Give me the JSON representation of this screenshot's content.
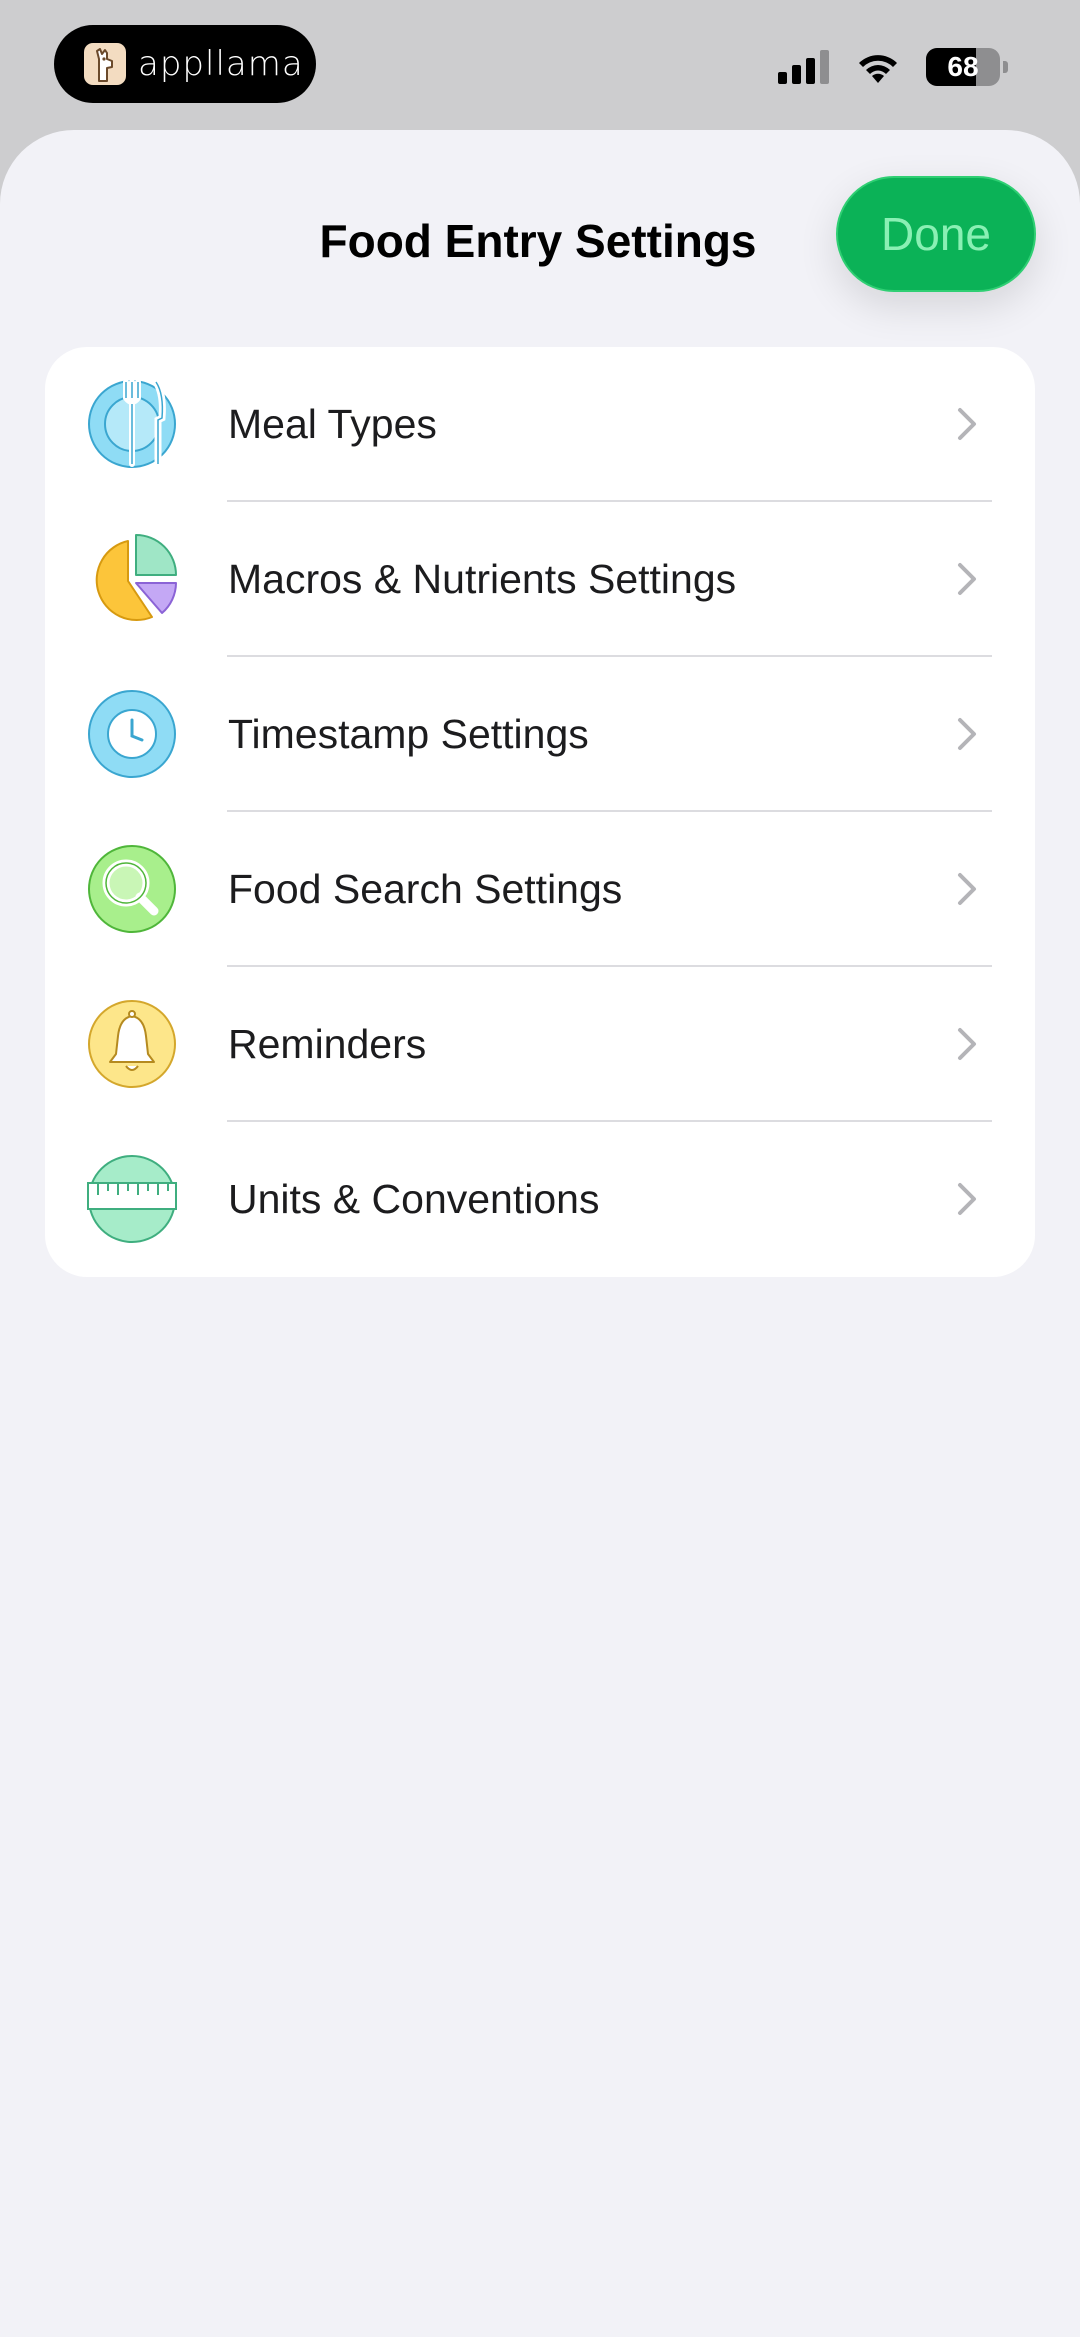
{
  "status_bar": {
    "app_name": "appllama",
    "battery_level": "68",
    "battery_fraction": 0.68
  },
  "sheet": {
    "title": "Food Entry Settings",
    "done_label": "Done"
  },
  "colors": {
    "accent_green": "#0bb257",
    "sheet_background": "#f2f2f7"
  },
  "settings": [
    {
      "label": "Meal Types",
      "icon": "plate-fork-knife-icon"
    },
    {
      "label": "Macros & Nutrients Settings",
      "icon": "pie-chart-icon"
    },
    {
      "label": "Timestamp Settings",
      "icon": "clock-icon"
    },
    {
      "label": "Food Search Settings",
      "icon": "magnifier-icon"
    },
    {
      "label": "Reminders",
      "icon": "bell-icon"
    },
    {
      "label": "Units & Conventions",
      "icon": "ruler-icon"
    }
  ]
}
